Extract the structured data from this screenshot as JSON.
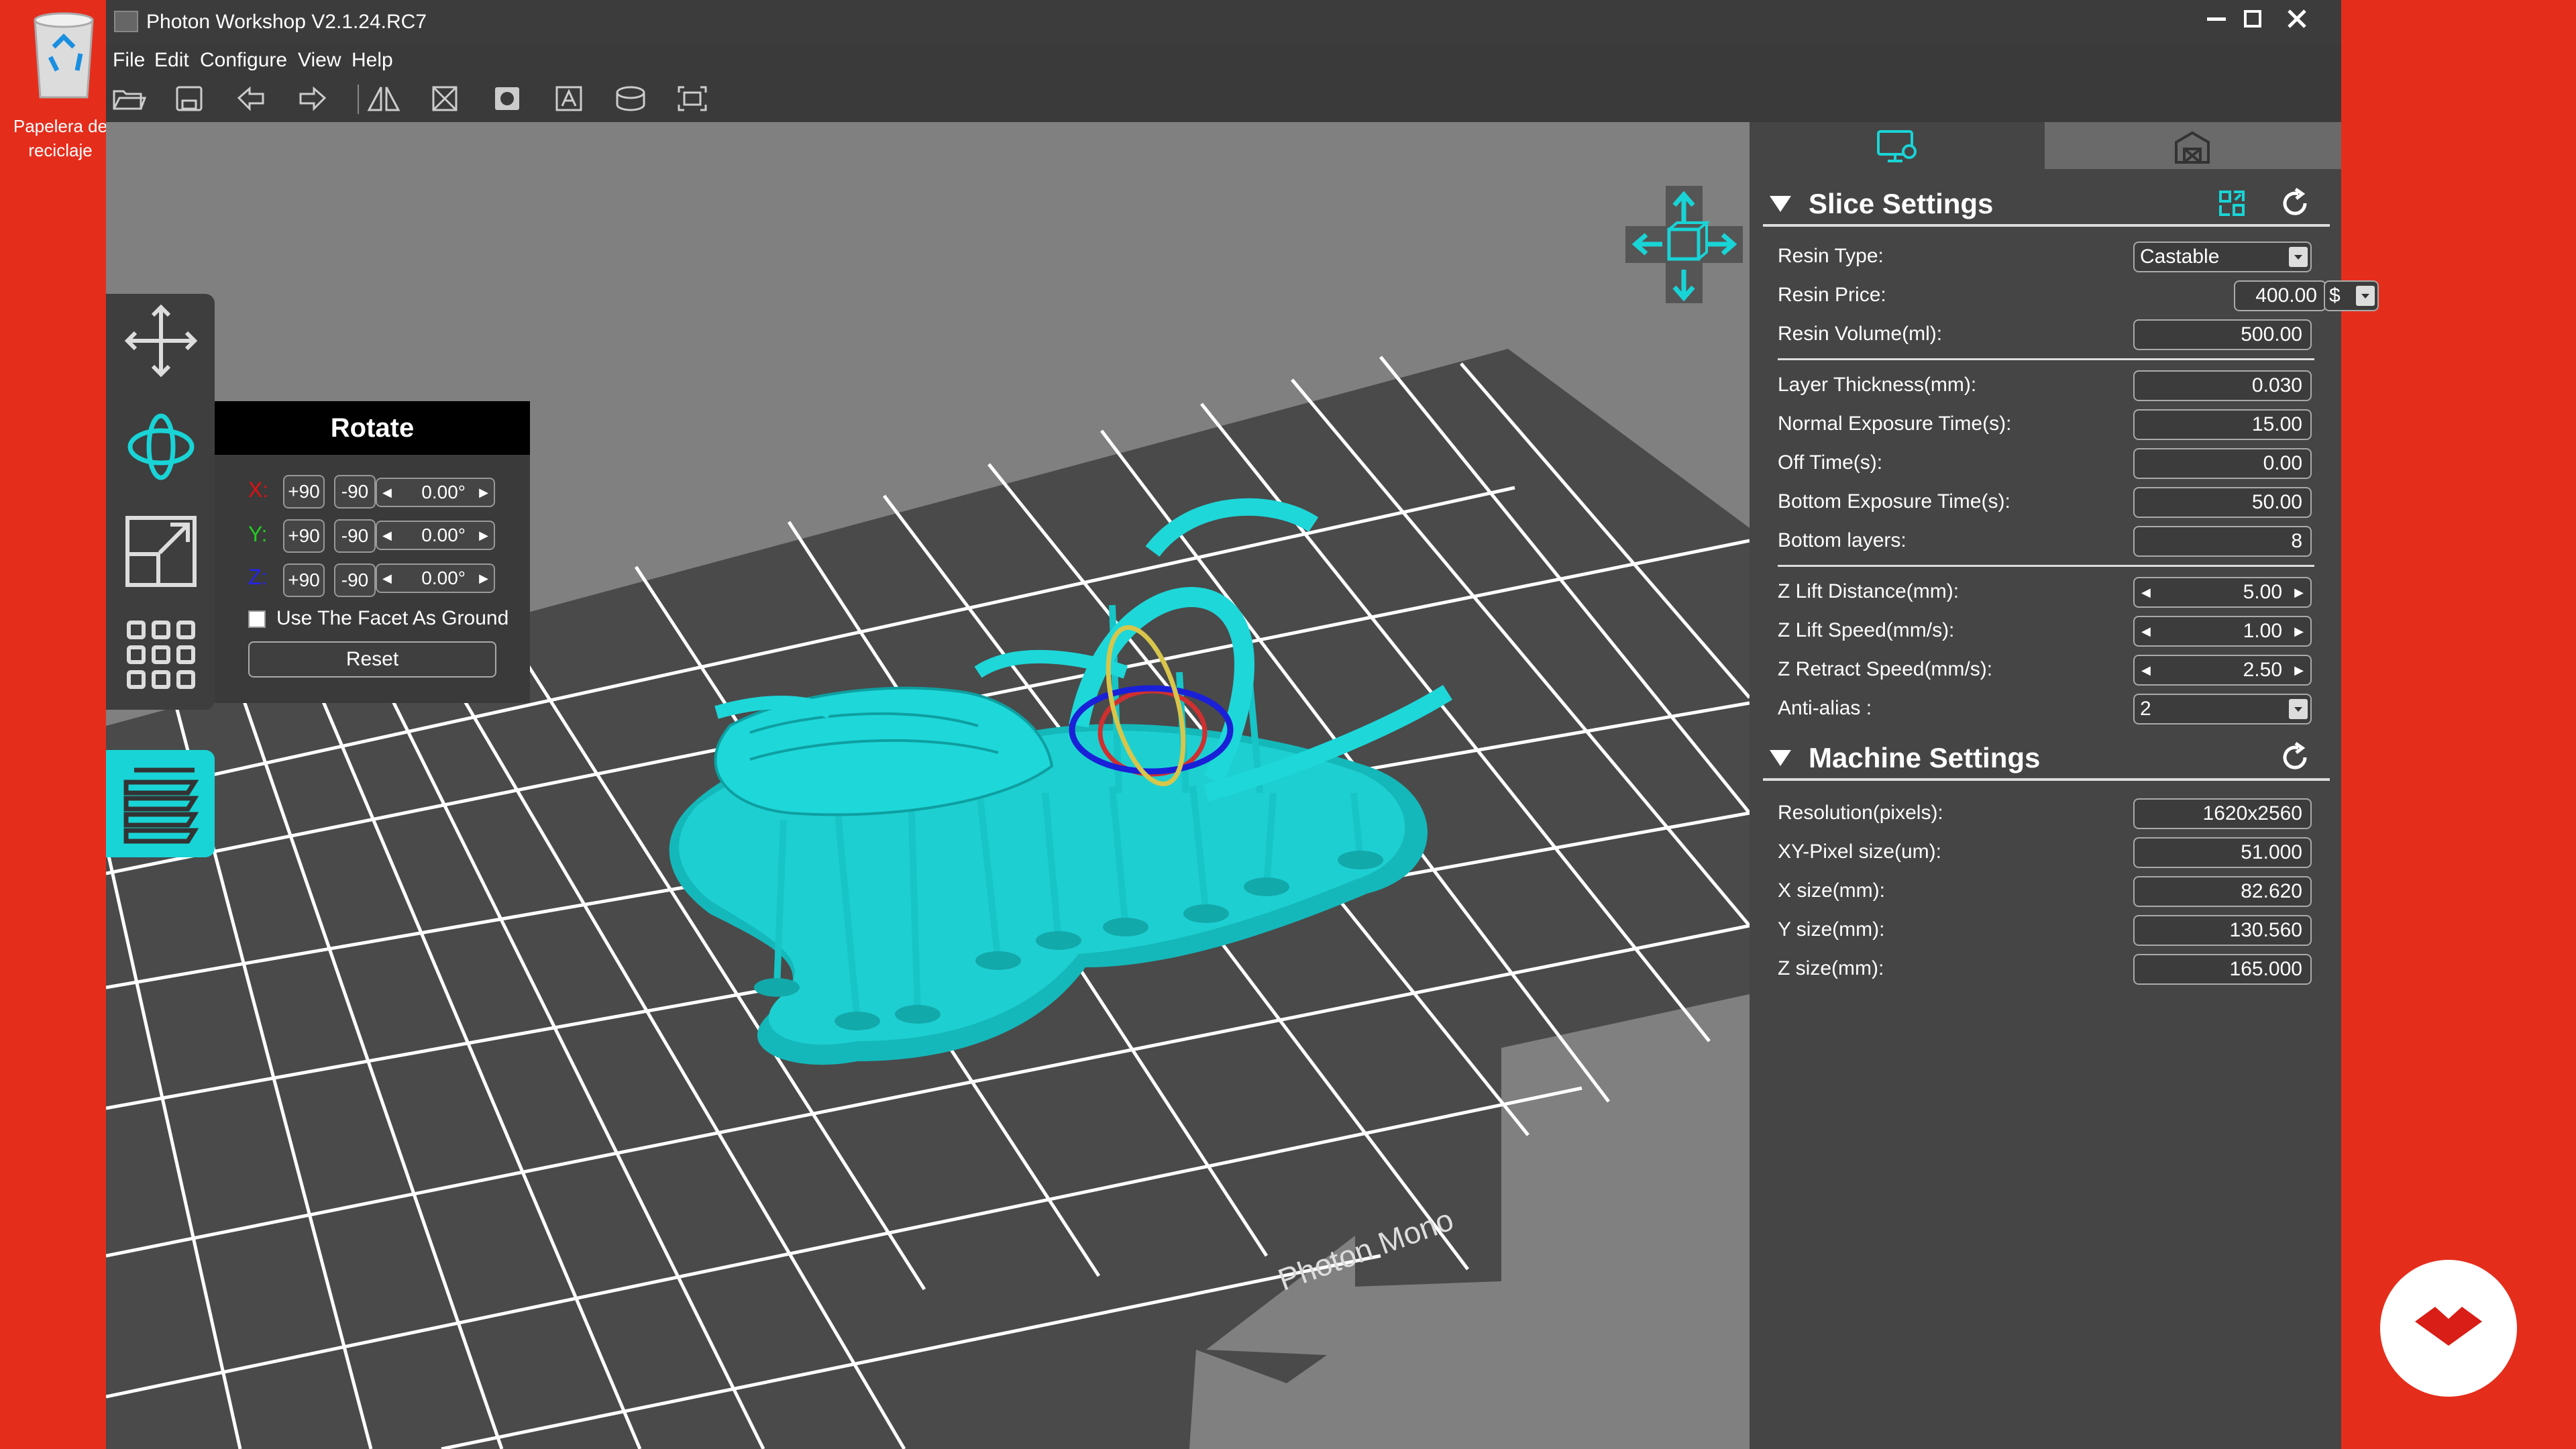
{
  "desktop": {
    "recycle_bin_label": "Papelera de reciclaje"
  },
  "window": {
    "title": "Photon Workshop V2.1.24.RC7"
  },
  "menu": [
    "File",
    "Edit",
    "Configure",
    "View",
    "Help"
  ],
  "toolbar_icons": [
    "open-icon",
    "save-icon",
    "undo-icon",
    "redo-icon",
    "mirror-icon",
    "hollow-icon",
    "punch-hole-icon",
    "text-icon",
    "cylinder-icon",
    "screenshot-icon"
  ],
  "rotate": {
    "title": "Rotate",
    "axes": [
      {
        "label": "X:",
        "plus": "+90",
        "minus": "-90",
        "value": "0.00°",
        "color": "#e01010"
      },
      {
        "label": "Y:",
        "plus": "+90",
        "minus": "-90",
        "value": "0.00°",
        "color": "#22cc22"
      },
      {
        "label": "Z:",
        "plus": "+90",
        "minus": "-90",
        "value": "0.00°",
        "color": "#2222ee"
      }
    ],
    "facet_checkbox": "Use The Facet As Ground",
    "reset": "Reset"
  },
  "bed_label": "Photon Mono",
  "slice": {
    "title": "Slice Settings",
    "resin_type": {
      "label": "Resin Type:",
      "value": "Castable"
    },
    "resin_price": {
      "label": "Resin Price:",
      "value": "400.00",
      "currency": "$"
    },
    "resin_volume": {
      "label": "Resin Volume(ml):",
      "value": "500.00"
    },
    "layer_thickness": {
      "label": "Layer Thickness(mm):",
      "value": "0.030"
    },
    "normal_exposure": {
      "label": "Normal Exposure Time(s):",
      "value": "15.00"
    },
    "off_time": {
      "label": "Off Time(s):",
      "value": "0.00"
    },
    "bottom_exposure": {
      "label": "Bottom Exposure Time(s):",
      "value": "50.00"
    },
    "bottom_layers": {
      "label": "Bottom layers:",
      "value": "8"
    },
    "z_lift_distance": {
      "label": "Z Lift Distance(mm):",
      "value": "5.00"
    },
    "z_lift_speed": {
      "label": "Z Lift Speed(mm/s):",
      "value": "1.00"
    },
    "z_retract_speed": {
      "label": "Z Retract Speed(mm/s):",
      "value": "2.50"
    },
    "anti_alias": {
      "label": "Anti-alias :",
      "value": "2"
    }
  },
  "machine": {
    "title": "Machine Settings",
    "resolution": {
      "label": "Resolution(pixels):",
      "value": "1620x2560"
    },
    "xy_pixel": {
      "label": "XY-Pixel size(um):",
      "value": "51.000"
    },
    "x_size": {
      "label": "X size(mm):",
      "value": "82.620"
    },
    "y_size": {
      "label": "Y size(mm):",
      "value": "130.560"
    },
    "z_size": {
      "label": "Z size(mm):",
      "value": "165.000"
    }
  },
  "colors": {
    "accent": "#19d4d6",
    "background": "#e52d1c",
    "panel": "#454545"
  }
}
